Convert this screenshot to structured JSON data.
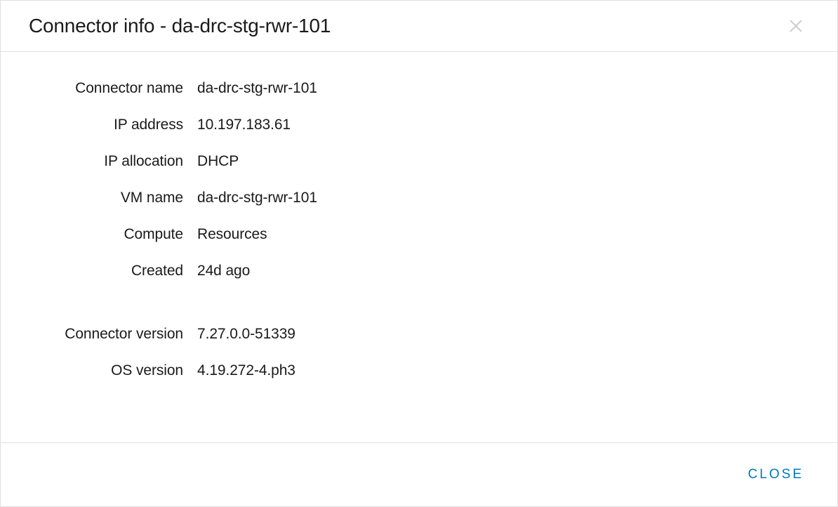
{
  "modal": {
    "title_prefix": "Connector info - ",
    "title_name": "da-drc-stg-rwr-101"
  },
  "info": {
    "group1": {
      "connector_name": {
        "label": "Connector name",
        "value": "da-drc-stg-rwr-101"
      },
      "ip_address": {
        "label": "IP address",
        "value": "10.197.183.61"
      },
      "ip_allocation": {
        "label": "IP allocation",
        "value": "DHCP"
      },
      "vm_name": {
        "label": "VM name",
        "value": "da-drc-stg-rwr-101"
      },
      "compute": {
        "label": "Compute",
        "value": "Resources"
      },
      "created": {
        "label": "Created",
        "value": "24d ago"
      }
    },
    "group2": {
      "connector_version": {
        "label": "Connector version",
        "value": "7.27.0.0-51339"
      },
      "os_version": {
        "label": "OS version",
        "value": "4.19.272-4.ph3"
      }
    }
  },
  "footer": {
    "close_label": "CLOSE"
  }
}
